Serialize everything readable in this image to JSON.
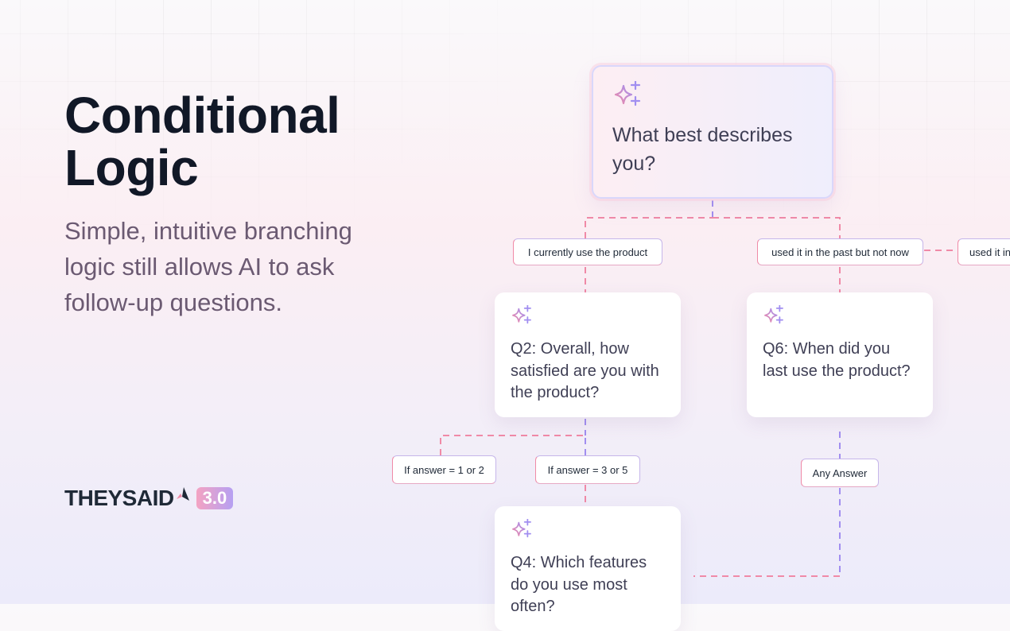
{
  "heading": {
    "title_line1": "Conditional",
    "title_line2": "Logic",
    "subtitle": "Simple, intuitive branching logic still allows AI to ask follow-up questions."
  },
  "brand": {
    "wordmark_prefix": "THEYS",
    "wordmark_ai": "AID",
    "version": "3.0"
  },
  "diagram": {
    "root_question": "What best describes you?",
    "branches": [
      "I currently use the product",
      "used it in the past but not now",
      "used it in"
    ],
    "q2": "Q2: Overall, how satisfied are you with the product?",
    "q6": "Q6: When did you last use the product?",
    "q2_branches": [
      "If answer = 1 or 2",
      "If answer = 3 or 5"
    ],
    "q6_branch": "Any Answer",
    "q4": "Q4: Which features do you use most often?"
  },
  "colors": {
    "accent_pink": "#f08aa7",
    "accent_purple": "#a18ef0",
    "title": "#111827",
    "subtitle": "#6b5a72"
  }
}
